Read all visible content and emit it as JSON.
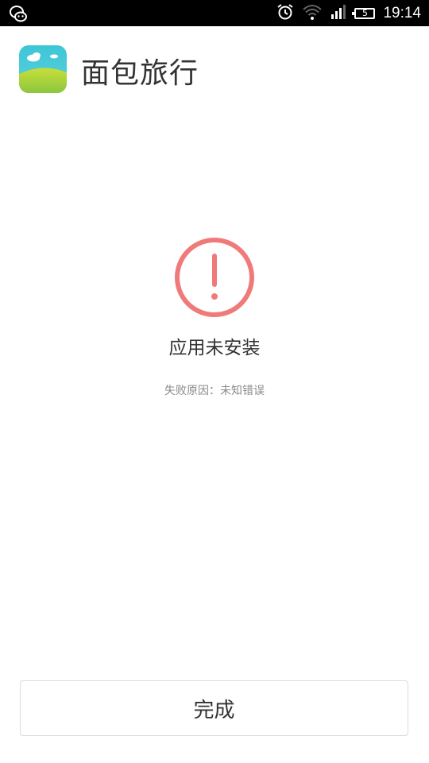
{
  "status_bar": {
    "time": "19:14",
    "battery_level": "5",
    "icons": [
      "wechat-icon",
      "alarm-clock-icon",
      "wifi-icon",
      "signal-icon",
      "battery-icon"
    ]
  },
  "app": {
    "name": "面包旅行",
    "icon": "app-icon-landscape"
  },
  "result": {
    "icon": "error-exclamation-icon",
    "title": "应用未安装",
    "reason": "失败原因：未知错误",
    "accent_color": "#f07a7a"
  },
  "actions": {
    "done_label": "完成"
  }
}
